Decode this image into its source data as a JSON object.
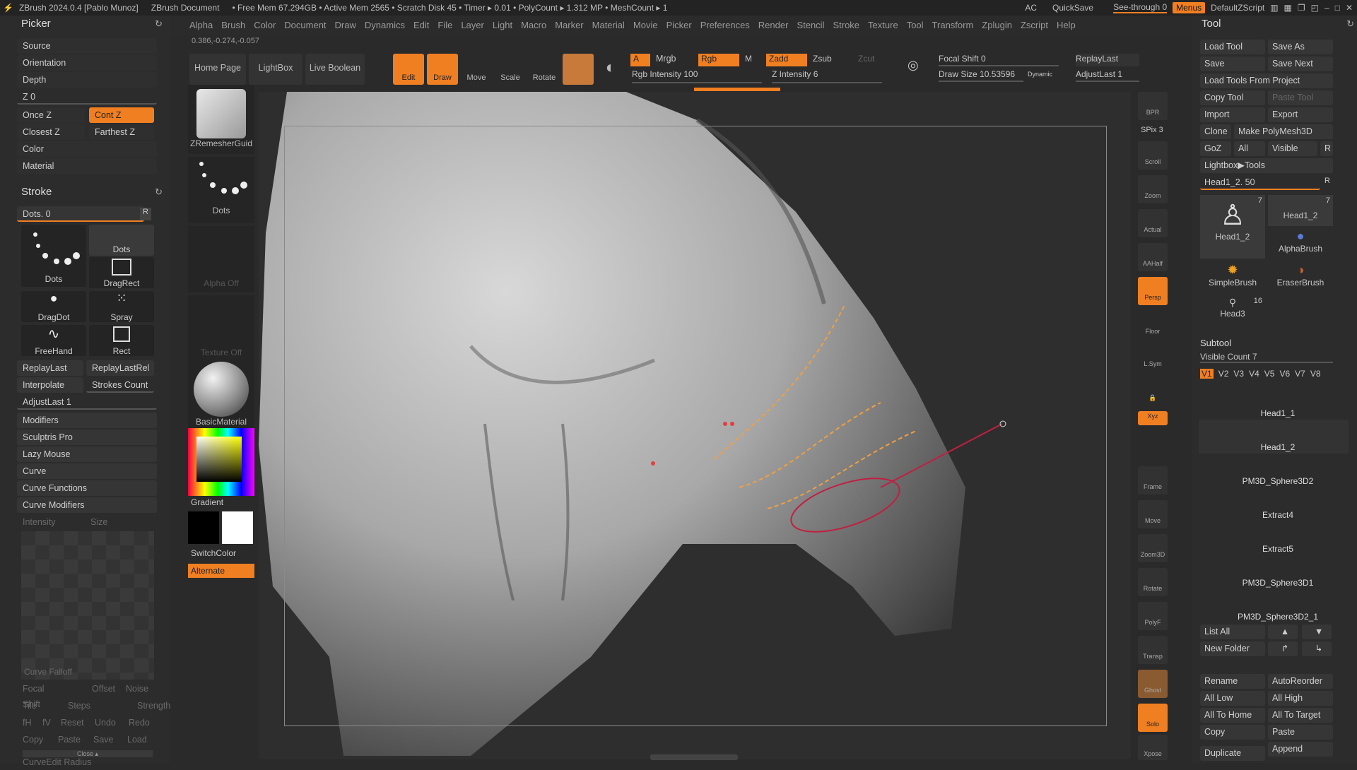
{
  "titlebar": {
    "app_title": "ZBrush 2024.0.4 [Pablo Munoz]",
    "doc": "ZBrush Document",
    "stats": "• Free Mem 67.294GB • Active Mem 2565 • Scratch Disk 45 • Timer ▸ 0.01 • PolyCount ▸ 1.312 MP • MeshCount ▸ 1",
    "ac": "AC",
    "quicksave": "QuickSave",
    "seethrough": "See-through  0",
    "menus": "Menus",
    "script": "DefaultZScript"
  },
  "menubar": [
    "Alpha",
    "Brush",
    "Color",
    "Document",
    "Draw",
    "Dynamics",
    "Edit",
    "File",
    "Layer",
    "Light",
    "Macro",
    "Marker",
    "Material",
    "Movie",
    "Picker",
    "Preferences",
    "Render",
    "Stencil",
    "Stroke",
    "Texture",
    "Tool",
    "Transform",
    "Zplugin",
    "Zscript",
    "Help"
  ],
  "coords": "0.386,-0.274,-0.057",
  "picker": {
    "title": "Picker",
    "source": "Source",
    "orientation": "Orientation",
    "depth": "Depth",
    "z": "Z 0",
    "oncez": "Once Z",
    "contz": "Cont Z",
    "closestz": "Closest Z",
    "farthestz": "Farthest Z",
    "color": "Color",
    "material": "Material"
  },
  "stroke": {
    "title": "Stroke",
    "dots_slider": "Dots. 0",
    "r": "R",
    "brushes": [
      "Dots",
      "Dots",
      "DragRect",
      "DragDot",
      "Spray",
      "FreeHand",
      "Rect"
    ],
    "replaylast": "ReplayLast",
    "replaylastrel": "ReplayLastRel",
    "interpolate": "Interpolate",
    "strokescount": "Strokes Count",
    "adjustlast": "AdjustLast 1",
    "modifiers": "Modifiers",
    "sculptris": "Sculptris Pro",
    "lazymouse": "Lazy Mouse",
    "curve": "Curve",
    "curvefunctions": "Curve Functions",
    "curvemodifiers": "Curve Modifiers",
    "intensity": "Intensity",
    "size": "Size",
    "curvefalloff": "Curve Falloff",
    "focalshift": "Focal Shift",
    "offset": "Offset",
    "noise": "Noise",
    "tile": "Tile",
    "steps": "Steps",
    "strength": "Strength",
    "fh": "fH",
    "fv": "fV",
    "reset": "Reset",
    "undo": "Undo",
    "redo": "Redo",
    "copy": "Copy",
    "paste": "Paste",
    "save": "Save",
    "load": "Load",
    "close": "Close ▴",
    "radius": "CurveEdit Radius"
  },
  "col2": {
    "zremesher": "ZRemesherGuid",
    "dots": "Dots",
    "alphaoff": "Alpha Off",
    "textureoff": "Texture Off",
    "material": "BasicMaterial",
    "gradient": "Gradient",
    "switchcolor": "SwitchColor",
    "alternate": "Alternate"
  },
  "toolbar": {
    "homepage": "Home Page",
    "lightbox": "LightBox",
    "liveboolean": "Live Boolean",
    "edit": "Edit",
    "draw": "Draw",
    "move": "Move",
    "scale": "Scale",
    "rotate": "Rotate",
    "a": "A",
    "mrgb": "Mrgb",
    "rgb": "Rgb",
    "m": "M",
    "zadd": "Zadd",
    "zsub": "Zsub",
    "zcut": "Zcut",
    "rgbintensity": "Rgb Intensity 100",
    "zintensity": "Z Intensity 6",
    "focalshift": "Focal Shift 0",
    "drawsize": "Draw Size 10.53596",
    "dynamic": "Dynamic",
    "replaylast": "ReplayLast",
    "adjustlast": "AdjustLast 1"
  },
  "rightcol": [
    "BPR",
    "SPix 3",
    "Scroll",
    "Zoom",
    "Actual",
    "AAHalf",
    "Persp",
    "Floor",
    "L.Sym",
    "Lock",
    "Xyz",
    "Frame",
    "Move",
    "Zoom3D",
    "Rotate",
    "PolyF",
    "Transp",
    "Ghost",
    "Solo",
    "Xpose"
  ],
  "tool": {
    "title": "Tool",
    "buttons": [
      "Load Tool",
      "Save As",
      "Save",
      "Save Next",
      "Load Tools From Project",
      "Copy Tool",
      "Paste Tool",
      "Import",
      "Export",
      "Clone",
      "Make PolyMesh3D",
      "GoZ",
      "All",
      "Visible",
      "R",
      "Lightbox▶Tools"
    ],
    "slider": "Head1_2. 50",
    "thumbs": [
      "Head1_2",
      "Head1_2",
      "AlphaBrush",
      "SimpleBrush",
      "EraserBrush",
      "Head3"
    ],
    "count7a": "7",
    "count7b": "7",
    "count16": "16",
    "subtool": "Subtool",
    "visiblecount": "Visible Count 7",
    "versions": [
      "V1",
      "V2",
      "V3",
      "V4",
      "V5",
      "V6",
      "V7",
      "V8"
    ],
    "subtools": [
      "Head1_1",
      "Head1_2",
      "PM3D_Sphere3D2",
      "Extract4",
      "Extract5",
      "PM3D_Sphere3D1",
      "PM3D_Sphere3D2_1"
    ],
    "listall": "List All",
    "newfolder": "New Folder",
    "bottom": [
      "Rename",
      "AutoReorder",
      "All Low",
      "All High",
      "All To Home",
      "All To Target",
      "Copy",
      "Paste",
      "Append",
      "Duplicate"
    ]
  },
  "colors": {
    "accent": "#f07f22",
    "panel": "#2c2c2c",
    "button": "#353535"
  }
}
